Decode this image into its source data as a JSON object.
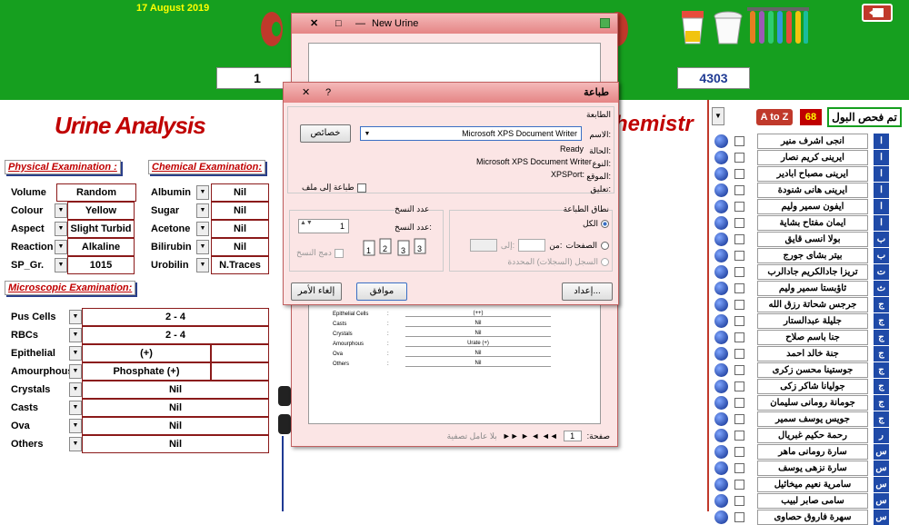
{
  "date": "17 August 2019",
  "header_fields": {
    "left_value": "1",
    "right_value": "4303"
  },
  "title": "Urine Analysis",
  "chem_title": "hemistr",
  "physical": {
    "heading": "Physical Examination :",
    "rows": [
      {
        "label": "Volume",
        "value": "Random Sample"
      },
      {
        "label": "Colour",
        "value": "Yellow"
      },
      {
        "label": "Aspect",
        "value": "Slight Turbid"
      },
      {
        "label": "Reaction",
        "value": "Alkaline"
      },
      {
        "label": "SP_Gr.",
        "value": "1015"
      }
    ]
  },
  "chemical": {
    "heading": "Chemical Examination:",
    "rows": [
      {
        "label": "Albumin",
        "value": "Nil"
      },
      {
        "label": "Sugar",
        "value": "Nil"
      },
      {
        "label": "Acetone",
        "value": "Nil"
      },
      {
        "label": "Bilirubin",
        "value": "Nil"
      },
      {
        "label": "Urobilin",
        "value": "N.Traces"
      }
    ]
  },
  "microscopic": {
    "heading": "Microscopic Examination:",
    "rows": [
      {
        "label": "Pus Cells",
        "value": "2 - 4",
        "extra": ""
      },
      {
        "label": "RBCs",
        "value": "2 - 4",
        "extra": ""
      },
      {
        "label": "Epithelial",
        "value": "(+)",
        "extra": " "
      },
      {
        "label": "Amourphous",
        "value": "Phosphate (+)",
        "extra": " "
      },
      {
        "label": "Crystals",
        "value": "Nil",
        "extra": ""
      },
      {
        "label": "Casts",
        "value": "Nil",
        "extra": ""
      },
      {
        "label": "Ova",
        "value": "Nil",
        "extra": ""
      },
      {
        "label": "Others",
        "value": "Nil",
        "extra": ""
      }
    ]
  },
  "preview_window": {
    "title": "New Urine",
    "report_rows": [
      {
        "label": "Epithelial Cells",
        "value": "(++)"
      },
      {
        "label": "Casts",
        "value": "Nil"
      },
      {
        "label": "Crystals",
        "value": "Nil"
      },
      {
        "label": "Amourphous",
        "value": "Urate (+)"
      },
      {
        "label": "Ova",
        "value": "Nil"
      },
      {
        "label": "Others",
        "value": "Nil"
      }
    ],
    "page_label": "صفحة:",
    "page_value": "1",
    "filter_label": "بلا عامل تصفية"
  },
  "print_dialog": {
    "title": "طباعة",
    "printer_group": "الطابعة",
    "name_label": "الاسم:",
    "printer_name": "Microsoft XPS Document Writer",
    "properties_btn": "خصائص",
    "status_label": "الحالة:",
    "status_value": "Ready",
    "type_label": "النوع:",
    "type_value": "Microsoft XPS Document Writer",
    "where_label": "الموقع:",
    "where_value": "XPSPort:",
    "comment_label": "تعليق:",
    "print_to_file": "طباعة إلى ملف",
    "range_group": "نطاق الطباعة",
    "all_label": "الكل",
    "pages_label": "الصفحات",
    "from_label": "من:",
    "to_label": "إلى:",
    "selected_records": "السجل (السجلات) المحددة",
    "copies_group": "عدد النسخ",
    "copies_label": "عدد النسخ:",
    "copies_value": "1",
    "collate_label": "دمج النسخ",
    "setup_btn": "إعداد...",
    "ok_btn": "موافق",
    "cancel_btn": "إلغاء الأمر"
  },
  "right_panel": {
    "title": "تم فحص البول",
    "count": "68",
    "sort_btn": "A to Z",
    "patients": [
      {
        "name": "انجى اشرف منير",
        "letter": "ا"
      },
      {
        "name": "ايرينى كريم نصار",
        "letter": "ا"
      },
      {
        "name": "ايرينى مصباح ابادير",
        "letter": "ا"
      },
      {
        "name": "ايرينى هانى شنودة",
        "letter": "ا"
      },
      {
        "name": "ايفون سمير وليم",
        "letter": "ا"
      },
      {
        "name": "ايمان مفتاح بشاية",
        "letter": "ا"
      },
      {
        "name": "بولا انسى قايق",
        "letter": "ب"
      },
      {
        "name": "بيتر بشاى جورج",
        "letter": "ب"
      },
      {
        "name": "تريزا جادالكريم جادالرب",
        "letter": "ت"
      },
      {
        "name": "ثاؤبستا سمير وليم",
        "letter": "ث"
      },
      {
        "name": "جرجس شحاتة رزق الله",
        "letter": "ج"
      },
      {
        "name": "جليلة عبدالستار",
        "letter": "ج"
      },
      {
        "name": "جنا باسم صلاح",
        "letter": "ج"
      },
      {
        "name": "جنة خالد احمد",
        "letter": "ج"
      },
      {
        "name": "جوستينا محسن زكرى",
        "letter": "ج"
      },
      {
        "name": "جوليانا شاكر زكى",
        "letter": "ج"
      },
      {
        "name": "جومانة رومانى سليمان",
        "letter": "ج"
      },
      {
        "name": "جويس يوسف سمير",
        "letter": "ج"
      },
      {
        "name": "رحمة حكيم غبريال",
        "letter": "ر"
      },
      {
        "name": "سارة رومانى ماهر",
        "letter": "س"
      },
      {
        "name": "سارة نزهى يوسف",
        "letter": "س"
      },
      {
        "name": "سامرية نعيم ميخائيل",
        "letter": "س"
      },
      {
        "name": "سامى صابر لبيب",
        "letter": "س"
      },
      {
        "name": "سهرة فاروق حصاوى",
        "letter": "س"
      }
    ]
  },
  "colors": {
    "header_green": "#169f1f",
    "title_red": "#c00000",
    "list_blue": "#1f4aa8"
  }
}
